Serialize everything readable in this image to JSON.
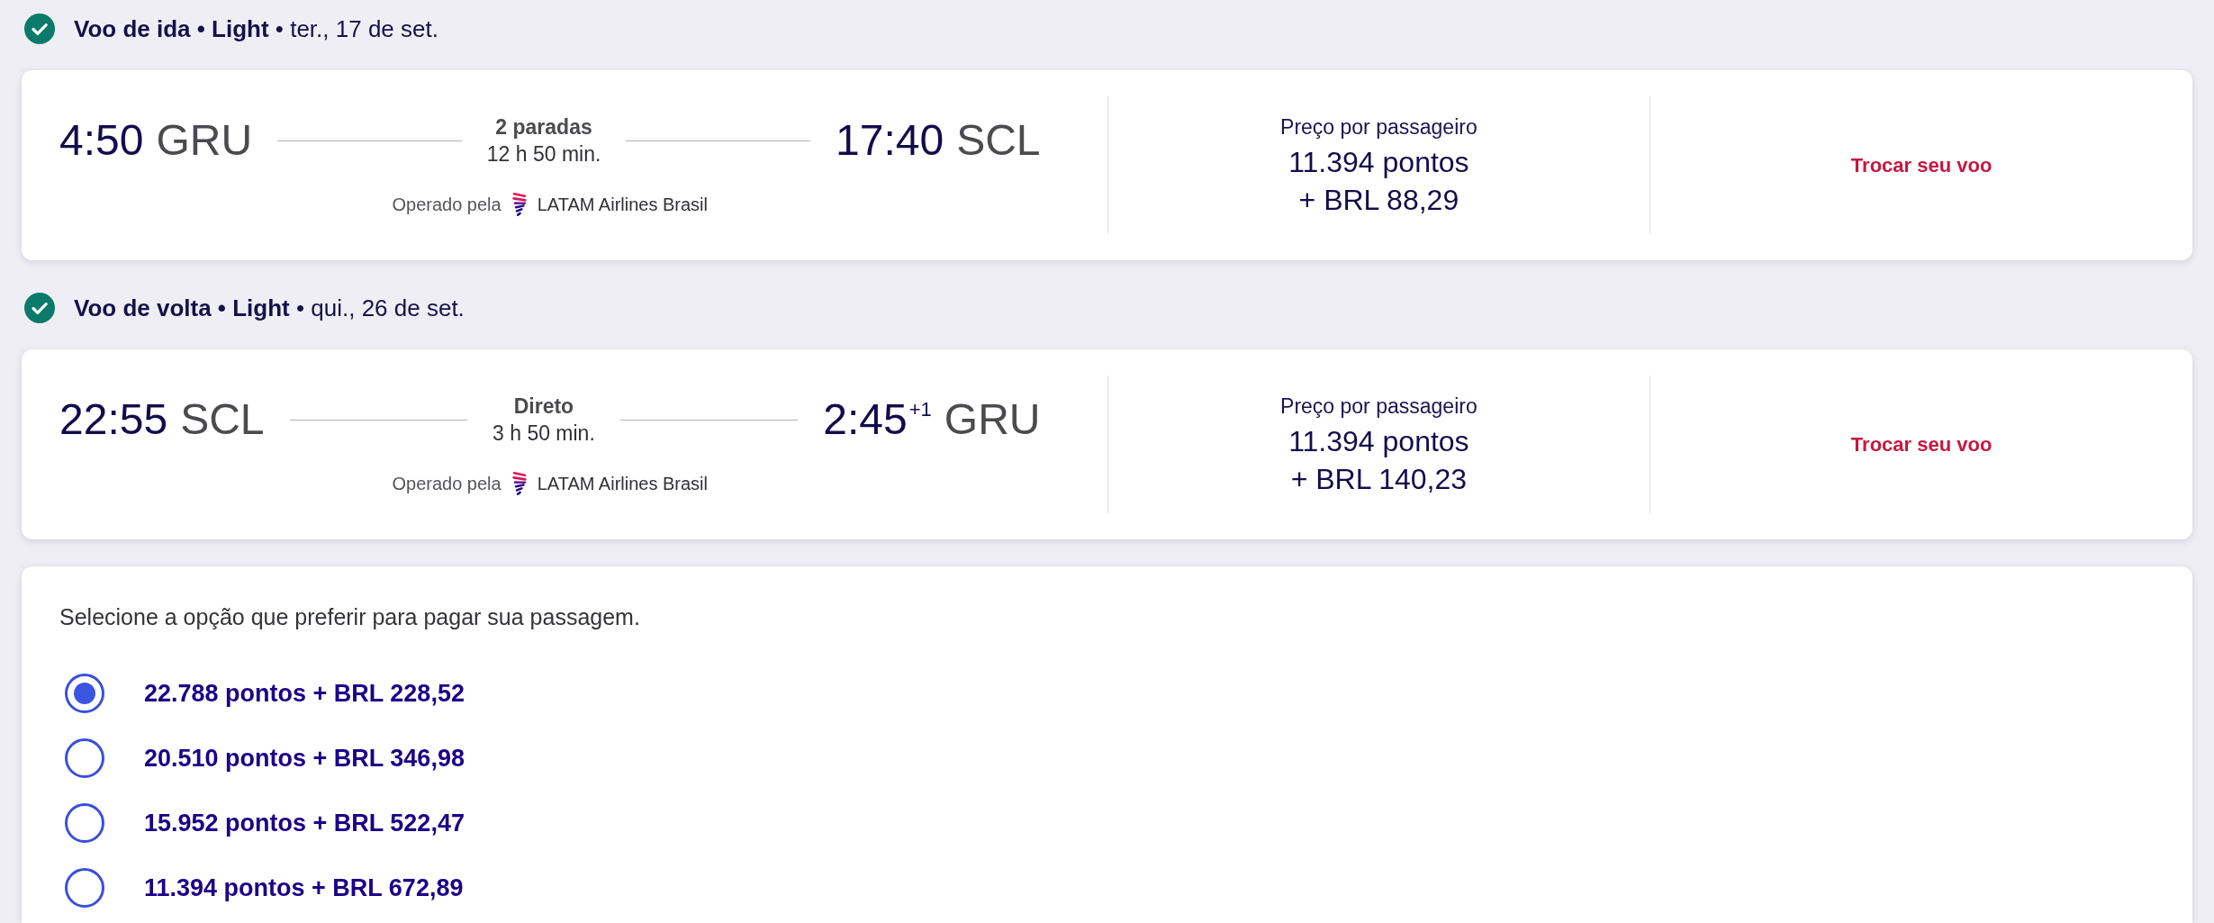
{
  "flights": [
    {
      "heading": "**Voo de ida • Light** • ter., 17 de set.",
      "departure": {
        "time": "4:50",
        "airport": "GRU"
      },
      "stops": "2 paradas",
      "duration": "12 h 50 min.",
      "arrival": {
        "time": "17:40",
        "airport": "SCL"
      },
      "operated_by": "Operado pela",
      "airline": "LATAM Airlines Brasil",
      "price_label": "Preço por passageiro",
      "points": "11.394 pontos",
      "cash": "+ BRL 88,29",
      "action": "Trocar seu voo"
    },
    {
      "heading": "**Voo de volta • Light** • qui., 26 de set.",
      "departure": {
        "time": "22:55",
        "airport": "SCL"
      },
      "stops": "Direto",
      "duration": "3 h 50 min.",
      "arrival": {
        "time": "2:45$^{+1}$",
        "airport": "GRU"
      },
      "operated_by": "Operado pela",
      "airline": "LATAM Airlines Brasil",
      "price_label": "Preço por passageiro",
      "points": "11.394 pontos",
      "cash": "+ BRL 140,23",
      "action": "Trocar seu voo"
    }
  ],
  "payment": {
    "prompt": "Selecione a opção que preferir para pagar sua passagem.",
    "options": [
      {
        "label": "22.788 pontos + BRL 228,52",
        "selected": true
      },
      {
        "label": "20.510 pontos + BRL 346,98",
        "selected": false
      },
      {
        "label": "15.952 pontos + BRL 522,47",
        "selected": false
      },
      {
        "label": "11.394 pontos + BRL 672,89",
        "selected": false
      }
    ]
  }
}
